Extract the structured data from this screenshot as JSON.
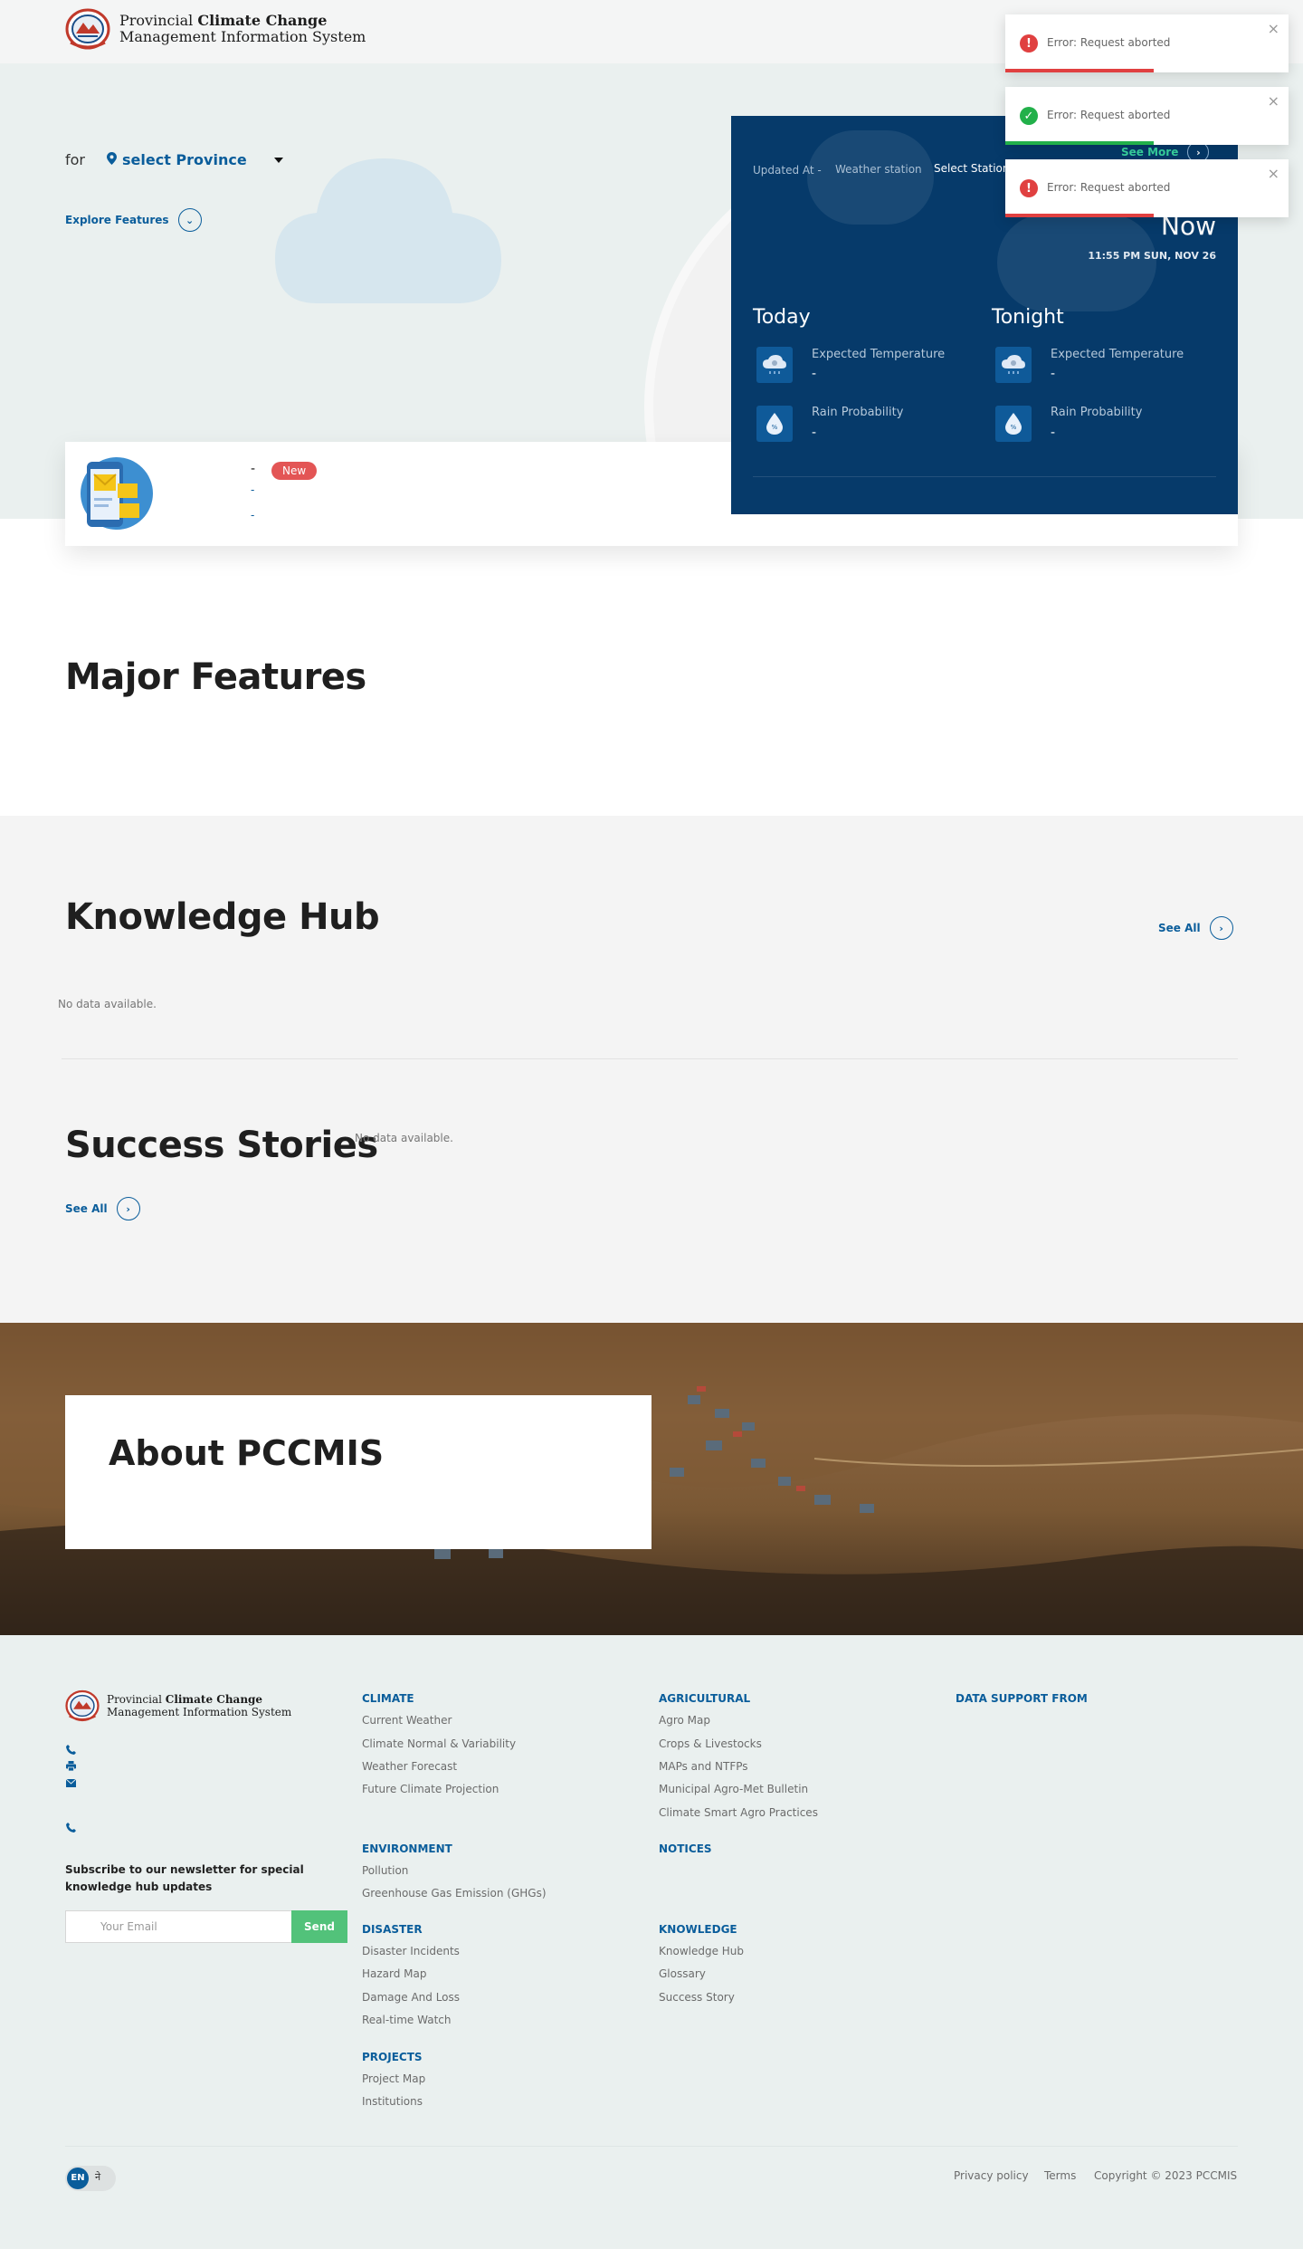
{
  "header": {
    "brand_prefix": "Provincial",
    "brand_bold": "Climate Change",
    "brand_line2": "Management Information System"
  },
  "hero": {
    "for_label": "for",
    "province_select": "select Province",
    "explore_label": "Explore Features"
  },
  "notice": {
    "title": "-",
    "badge": "New",
    "line2": "-",
    "line3": "-"
  },
  "weather": {
    "updated_label": "Updated At",
    "updated_value": "-",
    "station_label": "Weather station",
    "station_select": "Select Station",
    "see_more": "See More",
    "now_label": "Now",
    "date": "11:55 PM SUN, NOV 26",
    "today": {
      "title": "Today",
      "temp_label": "Expected Temperature",
      "temp_value": "-",
      "rain_label": "Rain Probability",
      "rain_value": "-"
    },
    "tonight": {
      "title": "Tonight",
      "temp_label": "Expected Temperature",
      "temp_value": "-",
      "rain_label": "Rain Probability",
      "rain_value": "-"
    }
  },
  "toasts": [
    {
      "message": "Error: Request aborted",
      "type": "error",
      "color": "#e04040"
    },
    {
      "message": "Error: Request aborted",
      "type": "success",
      "color": "#22b04a"
    },
    {
      "message": "Error: Request aborted",
      "type": "error",
      "color": "#e04040"
    }
  ],
  "major_features": {
    "title": "Major Features"
  },
  "knowledge_hub": {
    "title": "Knowledge Hub",
    "see_all": "See All",
    "empty": "No data available."
  },
  "success_stories": {
    "title": "Success Stories",
    "see_all": "See All",
    "empty": "No data available."
  },
  "about": {
    "title": "About PCCMIS"
  },
  "footer": {
    "climate": {
      "heading": "CLIMATE",
      "links": [
        "Current Weather",
        "Climate Normal & Variability",
        "Weather Forecast",
        "Future Climate Projection"
      ]
    },
    "agricultural": {
      "heading": "AGRICULTURAL",
      "links": [
        "Agro Map",
        "Crops & Livestocks",
        "MAPs and NTFPs",
        "Municipal Agro-Met Bulletin",
        "Climate Smart Agro Practices"
      ]
    },
    "data_support": {
      "heading": "DATA SUPPORT FROM"
    },
    "environment": {
      "heading": "ENVIRONMENT",
      "links": [
        "Pollution",
        "Greenhouse Gas Emission (GHGs)"
      ]
    },
    "notices": {
      "heading": "NOTICES"
    },
    "disaster": {
      "heading": "DISASTER",
      "links": [
        "Disaster Incidents",
        "Hazard Map",
        "Damage And Loss",
        "Real-time Watch"
      ]
    },
    "knowledge": {
      "heading": "KNOWLEDGE",
      "links": [
        "Knowledge Hub",
        "Glossary",
        "Success Story"
      ]
    },
    "projects": {
      "heading": "PROJECTS",
      "links": [
        "Project Map",
        "Institutions"
      ]
    },
    "newsletter_text": "Subscribe to our newsletter for special knowledge hub updates",
    "email_placeholder": "Your Email",
    "send_label": "Send",
    "lang_en": "EN",
    "lang_ne": "ने",
    "privacy": "Privacy policy",
    "terms": "Terms",
    "copyright": "Copyright © 2023 PCCMIS"
  }
}
